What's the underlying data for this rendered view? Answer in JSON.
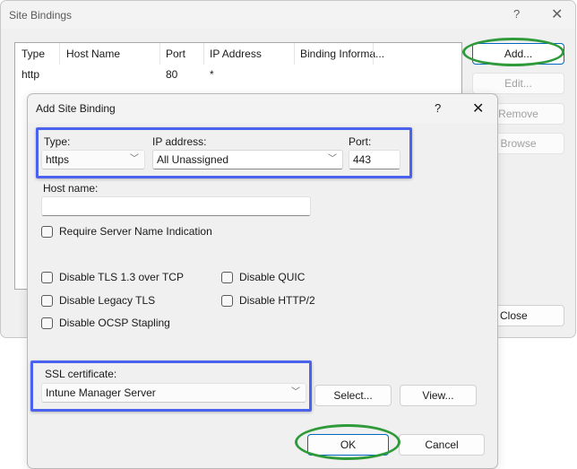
{
  "site_bindings": {
    "title": "Site Bindings",
    "help_label": "?",
    "close_label": "✕",
    "columns": [
      "Type",
      "Host Name",
      "Port",
      "IP Address",
      "Binding Informa..."
    ],
    "rows": [
      {
        "type": "http",
        "host_name": "",
        "port": "80",
        "ip_address": "*",
        "binding_info": ""
      }
    ],
    "buttons": {
      "add": "Add...",
      "edit": "Edit...",
      "remove": "Remove",
      "browse": "Browse",
      "close": "Close"
    }
  },
  "add_site_binding": {
    "title": "Add Site Binding",
    "help_label": "?",
    "close_label": "✕",
    "type_label": "Type:",
    "type_value": "https",
    "ip_label": "IP address:",
    "ip_value": "All Unassigned",
    "port_label": "Port:",
    "port_value": "443",
    "host_label": "Host name:",
    "host_value": "",
    "sni_label": "Require Server Name Indication",
    "options": {
      "disable_tls13": "Disable TLS 1.3 over TCP",
      "disable_quic": "Disable QUIC",
      "disable_legacy_tls": "Disable Legacy TLS",
      "disable_http2": "Disable HTTP/2",
      "disable_ocsp": "Disable OCSP Stapling"
    },
    "checked": {
      "sni": false,
      "disable_tls13": false,
      "disable_quic": false,
      "disable_legacy_tls": false,
      "disable_http2": false,
      "disable_ocsp": false
    },
    "ssl_label": "SSL certificate:",
    "ssl_value": "Intune Manager Server",
    "buttons": {
      "select": "Select...",
      "view": "View...",
      "ok": "OK",
      "cancel": "Cancel"
    },
    "chevron": "﹀"
  },
  "annotations": {
    "highlight_blue": "#4b62ef",
    "highlight_green": "#2f9a3a"
  }
}
